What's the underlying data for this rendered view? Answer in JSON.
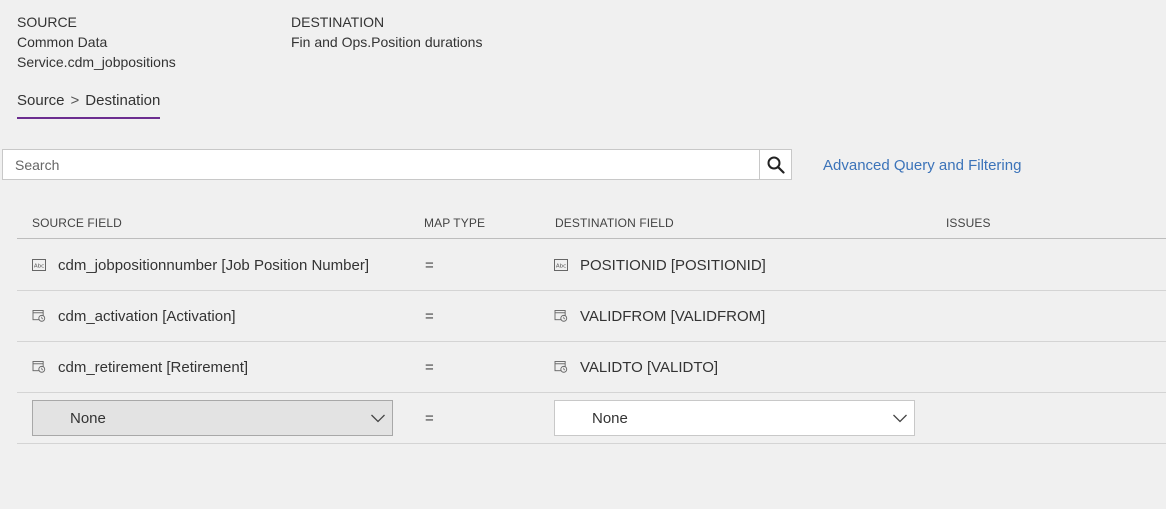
{
  "header": {
    "source_caption": "SOURCE",
    "source_line1": "Common Data",
    "source_line2": "Service.cdm_jobpositions",
    "destination_caption": "DESTINATION",
    "destination_value": "Fin and Ops.Position durations"
  },
  "tab": {
    "source": "Source",
    "separator": ">",
    "destination": "Destination"
  },
  "search": {
    "placeholder": "Search",
    "value": ""
  },
  "advanced_link": "Advanced Query and Filtering",
  "columns": {
    "source_field": "SOURCE FIELD",
    "map_type": "MAP TYPE",
    "destination_field": "DESTINATION FIELD",
    "issues": "ISSUES"
  },
  "rows": [
    {
      "source": "cdm_jobpositionnumber [Job Position Number]",
      "source_icon": "text-field-icon",
      "map": "=",
      "destination": "POSITIONID [POSITIONID]",
      "destination_icon": "text-field-icon",
      "issues": ""
    },
    {
      "source": "cdm_activation [Activation]",
      "source_icon": "datetime-field-icon",
      "map": "=",
      "destination": "VALIDFROM [VALIDFROM]",
      "destination_icon": "datetime-field-icon",
      "issues": ""
    },
    {
      "source": "cdm_retirement [Retirement]",
      "source_icon": "datetime-field-icon",
      "map": "=",
      "destination": "VALIDTO [VALIDTO]",
      "destination_icon": "datetime-field-icon",
      "issues": ""
    }
  ],
  "new_row": {
    "source_select": "None",
    "map": "=",
    "destination_select": "None"
  },
  "colors": {
    "accent_underline": "#6b2d8f",
    "link": "#3b73b9",
    "background": "#f0f0f0"
  }
}
